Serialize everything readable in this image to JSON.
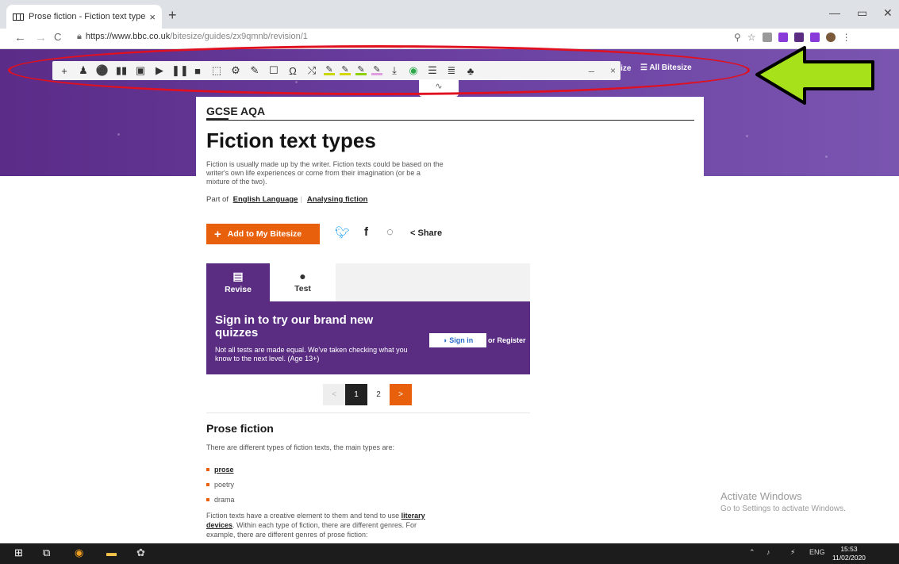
{
  "browser": {
    "tab_title": "Prose fiction - Fiction text types",
    "tab_close": "×",
    "new_tab": "+",
    "url_host": "https://www.bbc.co.uk",
    "url_path": "/bitesize/guides/zx9qmnb/revision/1",
    "minimize": "—",
    "restore": "▭",
    "close": "✕"
  },
  "reading_toolbar": {
    "tools": [
      "+",
      "♟",
      "⚫",
      "▮▮",
      "▣",
      "▶",
      "❚❚",
      "■",
      "⬚",
      "⚙",
      "✎",
      "☐",
      "Ω",
      "⤭"
    ],
    "highlighter_colors": [
      "#c8d800",
      "#d7d700",
      "#8fd000",
      "#e0a0e0"
    ],
    "more_tools": [
      "⤓",
      "◉",
      "☰",
      "≣",
      "♣"
    ],
    "minimize": "–",
    "close": "×",
    "bitesize_partial": "esize",
    "all_bitesize": "All Bitesize",
    "handle": "∿"
  },
  "annotation": {
    "ellipse_color": "#e01020",
    "arrow_color": "#a6e11a"
  },
  "page": {
    "course": "GCSE AQA",
    "title": "Fiction text types",
    "intro": "Fiction is usually made up by the writer. Fiction texts could be based on the writer's own life experiences or come from their imagination (or be a mixture of the two).",
    "part_of_label": "Part of",
    "part_of_1": "English Language",
    "part_of_2": "Analysing fiction",
    "add_button": "Add to My Bitesize",
    "share_label": "Share",
    "tabs": {
      "revise": "Revise",
      "test": "Test"
    },
    "signin": {
      "heading": "Sign in to try our brand new quizzes",
      "text": "Not all tests are made equal. We've taken checking what you know to the next level. (Age 13+)",
      "button": "Sign in",
      "register": "or Register"
    },
    "pager": {
      "prev": "<",
      "current": "1",
      "next_page": "2",
      "next": ">"
    },
    "section_title": "Prose fiction",
    "section_lead": "There are different types of fiction texts, the main types are:",
    "list": [
      "prose",
      "poetry",
      "drama"
    ],
    "para_1": "Fiction texts have a creative element to them and tend to use",
    "para_link": "literary devices",
    "para_2": ". Within each type of fiction, there are different genres. For example, there are different genres of prose fiction:"
  },
  "watermark": {
    "line1": "Activate Windows",
    "line2": "Go to Settings to activate Windows."
  },
  "taskbar": {
    "lang": "ENG",
    "time": "15:53",
    "date": "11/02/2020"
  },
  "colors": {
    "bbc_purple": "#5a2d82",
    "bitesize_orange": "#e8600c"
  }
}
